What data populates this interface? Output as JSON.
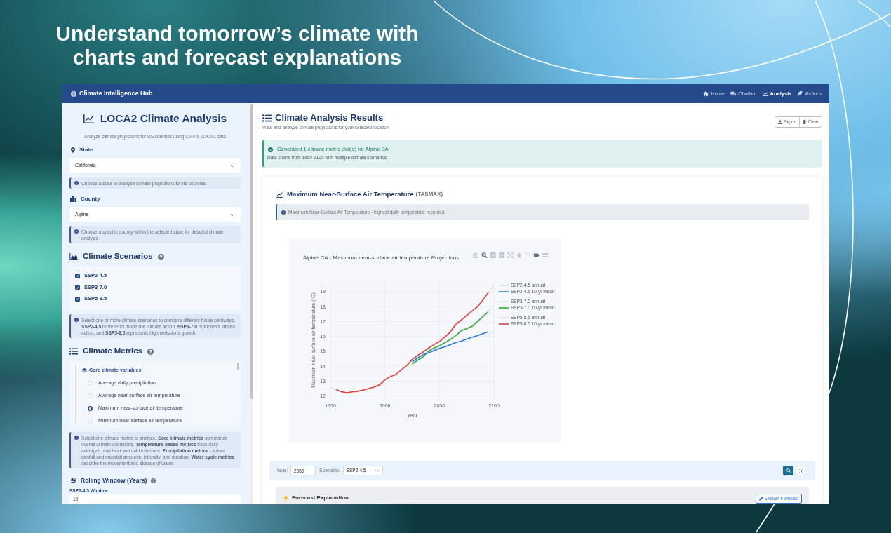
{
  "headline": {
    "lines": [
      "Understand tomorrow’s climate with",
      "charts and forecast explanations"
    ]
  },
  "navbar": {
    "brand": "Climate Intelligence Hub",
    "links": [
      {
        "label": "Home",
        "selected": false
      },
      {
        "label": "Chatbot",
        "selected": false
      },
      {
        "label": "Analysis",
        "selected": true
      },
      {
        "label": "Actions",
        "selected": false
      }
    ]
  },
  "sidebar": {
    "title": "LOCA2 Climate Analysis",
    "subtitle": "Analyze climate projections for US counties using CMIP6-LOCA2 data",
    "state": {
      "label": "State",
      "value": "California",
      "hint": "Choose a state to analyze climate projections for its counties"
    },
    "county": {
      "label": "County",
      "value": "Alpine",
      "hint": "Choose a specific county within the selected state for detailed climate analysis"
    },
    "scenarios": {
      "heading": "Climate Scenarios",
      "options": [
        {
          "label": "SSP2-4.5",
          "checked": true
        },
        {
          "label": "SSP3-7.0",
          "checked": true
        },
        {
          "label": "SSP5-8.5",
          "checked": true
        }
      ],
      "note": "Select one or more climate scenarios to compare different future pathways. **SSP2-4.5** represents moderate climate action, **SSP3-7.0** represents limited action, and **SSP5-8.5** represents high emissions growth."
    },
    "metrics": {
      "heading": "Climate Metrics",
      "group": "Core climate variables",
      "options": [
        {
          "label": "Average daily precipitation",
          "selected": false
        },
        {
          "label": "Average near-surface air temperature",
          "selected": false
        },
        {
          "label": "Maximum near-surface air temperature",
          "selected": true
        },
        {
          "label": "Minimum near-surface air temperature",
          "selected": false
        }
      ],
      "note": "Select one climate metric to analyze. **Core climate metrics** summarize overall climate conditions. **Temperature-based metrics** track daily averages, and heat and cold extremes. **Precipitation metrics** capture rainfall and snowfall amounts, intensity, and duration. **Water cycle metrics** describe the movement and storage of water."
    },
    "rolling_window": {
      "heading": "Rolling Window (Years)",
      "field_label": "SSP2-4.5 Window:",
      "value": "10"
    }
  },
  "results": {
    "title": "Climate Analysis Results",
    "subtitle": "View and analyze climate projections for your selected location",
    "actions": [
      "Export",
      "Clear"
    ],
    "alert": {
      "title": "Generated 1 climate metric plot(s) for Alpine CA",
      "detail": "Data spans from 1950-2100 with multiple climate scenarios"
    },
    "metric_card": {
      "title": "Maximum Near-Surface Air Temperature",
      "code": "(TASMAX)",
      "description": "Maximum Near-Surface Air Temperature - highest daily temperature recorded",
      "chart_data": {
        "type": "line",
        "title": "Alpine CA - Maximum near-surface air temperature Projections",
        "xlabel": "Year",
        "ylabel": "Maximum near-surface air temperature (°C)",
        "grid": true,
        "legend": "right",
        "x": [
          1950,
          1955,
          1960,
          1965,
          1970,
          1975,
          1980,
          1985,
          1990,
          1995,
          2000,
          2005,
          2010,
          2015,
          2020,
          2025,
          2030,
          2035,
          2040,
          2045,
          2050,
          2055,
          2060,
          2065,
          2070,
          2075,
          2080,
          2085,
          2090,
          2095,
          2100
        ],
        "xlim": [
          1950,
          2100
        ],
        "ylim": [
          11.8,
          19.7
        ],
        "xticks": [
          1950,
          2000,
          2050,
          2100
        ],
        "yticks": [
          12,
          13,
          14,
          15,
          16,
          17,
          18,
          19
        ],
        "series": [
          {
            "name": "SSP2-4.5 annual",
            "color": "#c9dcf0",
            "values": [
              null,
              null,
              null,
              null,
              null,
              null,
              null,
              null,
              null,
              null,
              null,
              null,
              null,
              null,
              14.0,
              14.35,
              14.5,
              14.7,
              14.9,
              15.15,
              15.2,
              15.35,
              15.45,
              15.55,
              15.7,
              15.65,
              15.85,
              16.0,
              16.15,
              16.1,
              16.4
            ]
          },
          {
            "name": "SSP2-4.5 10-yr mean",
            "color": "#2f7bd0",
            "values": [
              null,
              null,
              null,
              null,
              null,
              null,
              null,
              null,
              null,
              null,
              null,
              null,
              null,
              null,
              null,
              14.3,
              14.55,
              14.78,
              14.9,
              15.05,
              15.2,
              15.3,
              15.45,
              15.6,
              15.68,
              15.82,
              15.95,
              16.05,
              16.2,
              16.3,
              null
            ]
          },
          {
            "name": "SSP3-7.0 annual",
            "color": "#cdeacb",
            "values": [
              null,
              null,
              null,
              null,
              null,
              null,
              null,
              null,
              null,
              null,
              null,
              null,
              null,
              null,
              13.95,
              14.2,
              14.4,
              14.75,
              14.85,
              15.2,
              15.3,
              15.55,
              15.7,
              16.1,
              16.3,
              16.5,
              16.6,
              17.05,
              17.3,
              17.75,
              17.85
            ]
          },
          {
            "name": "SSP3-7.0 10-yr mean",
            "color": "#34a83a",
            "values": [
              null,
              null,
              null,
              null,
              null,
              null,
              null,
              null,
              null,
              null,
              null,
              null,
              null,
              null,
              null,
              14.15,
              14.4,
              14.62,
              15.02,
              15.22,
              15.38,
              15.58,
              15.8,
              16.05,
              16.38,
              16.52,
              16.68,
              17.0,
              17.35,
              17.65,
              null
            ]
          },
          {
            "name": "SSP5-8.5 annual",
            "color": "#f6cccc",
            "values": [
              12.6,
              12.45,
              12.3,
              12.15,
              12.35,
              12.25,
              12.5,
              12.45,
              12.8,
              12.6,
              13.05,
              13.45,
              13.35,
              13.8,
              14.05,
              14.4,
              14.7,
              14.9,
              15.25,
              15.45,
              15.9,
              16.0,
              16.35,
              16.9,
              17.05,
              17.5,
              17.75,
              18.05,
              18.5,
              19.0,
              19.4
            ]
          },
          {
            "name": "SSP5-8.5 10-yr mean",
            "color": "#e2403f",
            "values": [
              null,
              12.45,
              12.3,
              12.22,
              12.28,
              12.32,
              12.4,
              12.5,
              12.6,
              12.75,
              13.1,
              13.3,
              13.45,
              13.75,
              14.05,
              14.45,
              14.72,
              14.95,
              15.22,
              15.45,
              15.65,
              15.95,
              16.3,
              16.8,
              17.1,
              17.4,
              17.7,
              18.0,
              18.45,
              18.95,
              null
            ]
          }
        ]
      }
    },
    "controls": {
      "year_label": "Year:",
      "year": "2050",
      "scenario_label": "Scenario:",
      "scenario": "SSP2-4.5"
    },
    "forecast": {
      "title": "Forecast Explanation",
      "button": "Explain Forecast"
    }
  }
}
